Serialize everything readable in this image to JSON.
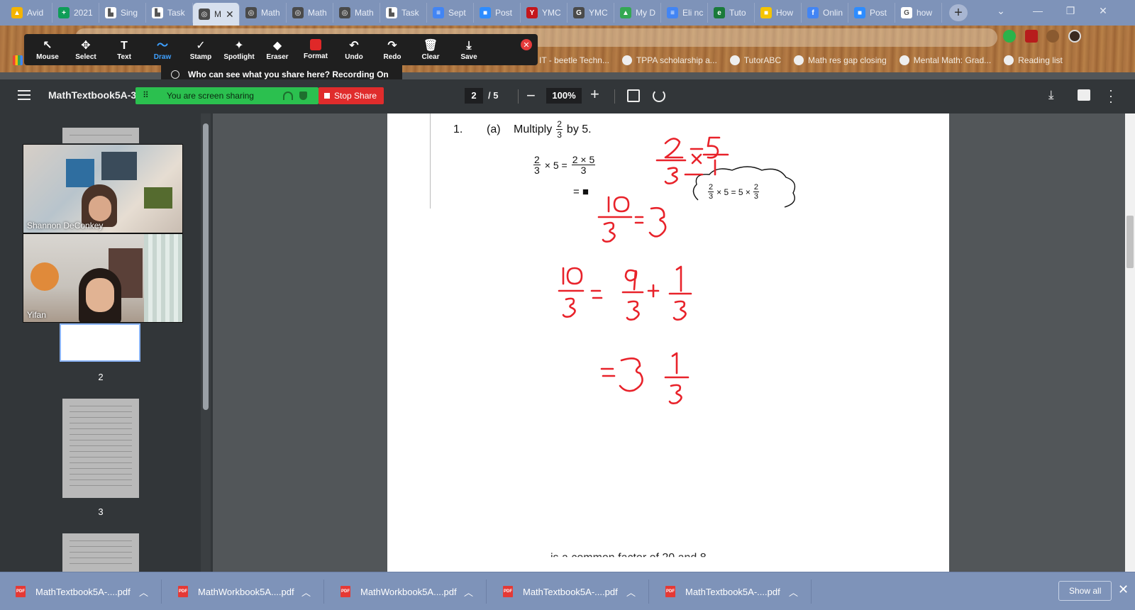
{
  "browser": {
    "tabs": [
      {
        "label": "Avid",
        "color": "#f4b400",
        "glyph": "▲"
      },
      {
        "label": "2021",
        "color": "#0f9d58",
        "glyph": "+"
      },
      {
        "label": "Sing",
        "color": "#ffffff",
        "glyph": "▙"
      },
      {
        "label": "Task",
        "color": "#ffffff",
        "glyph": "▙"
      },
      {
        "label": "M",
        "color": "#4a4a4a",
        "glyph": "◎",
        "active": true
      },
      {
        "label": "Math",
        "color": "#4a4a4a",
        "glyph": "◎"
      },
      {
        "label": "Math",
        "color": "#4a4a4a",
        "glyph": "◎"
      },
      {
        "label": "Math",
        "color": "#4a4a4a",
        "glyph": "◎"
      },
      {
        "label": "Task",
        "color": "#ffffff",
        "glyph": "▙"
      },
      {
        "label": "Sept",
        "color": "#4285f4",
        "glyph": "≡"
      },
      {
        "label": "Post",
        "color": "#2d8cff",
        "glyph": "■"
      },
      {
        "label": "YMC",
        "color": "#c4161c",
        "glyph": "Y"
      },
      {
        "label": "YMC",
        "color": "#4a4a4a",
        "glyph": "G"
      },
      {
        "label": "My D",
        "color": "#34a853",
        "glyph": "▲"
      },
      {
        "label": "Eli nc",
        "color": "#4285f4",
        "glyph": "≡"
      },
      {
        "label": "Tuto",
        "color": "#1a7a3a",
        "glyph": "e"
      },
      {
        "label": "How",
        "color": "#f4c400",
        "glyph": "■"
      },
      {
        "label": "Onlin",
        "color": "#4285f4",
        "glyph": "f"
      },
      {
        "label": "Post",
        "color": "#2d8cff",
        "glyph": "■"
      },
      {
        "label": "how",
        "color": "#ffffff",
        "glyph": "G"
      }
    ]
  },
  "bookmarks": [
    {
      "label": "IT - beetle Techn..."
    },
    {
      "label": "TPPA scholarship a..."
    },
    {
      "label": "TutorABC"
    },
    {
      "label": "Math res gap closing"
    },
    {
      "label": "Mental Math: Grad..."
    },
    {
      "label": "Reading list"
    }
  ],
  "zoom_toolbar": {
    "tools": [
      {
        "label": "Mouse",
        "icon": "↖"
      },
      {
        "label": "Select",
        "icon": "✥"
      },
      {
        "label": "Text",
        "icon": "T"
      },
      {
        "label": "Draw",
        "icon": "〜",
        "active": true
      },
      {
        "label": "Stamp",
        "icon": "✓"
      },
      {
        "label": "Spotlight",
        "icon": "✦"
      },
      {
        "label": "Eraser",
        "icon": "◆"
      },
      {
        "label": "Format",
        "icon": "rec"
      },
      {
        "label": "Undo",
        "icon": "↶"
      },
      {
        "label": "Redo",
        "icon": "↷"
      },
      {
        "label": "Clear",
        "icon": "🗑"
      },
      {
        "label": "Save",
        "icon": "⤓"
      }
    ],
    "share_notice": "Who can see what you share here? Recording On"
  },
  "pdf_toolbar": {
    "title": "MathTextbook5A-3-",
    "sharing_label": "You are screen sharing",
    "stop_share_label": "Stop Share",
    "current_page": "2",
    "page_separator": "/ 5",
    "zoom_level": "100%"
  },
  "sidebar": {
    "participants": [
      {
        "name": "Shannon DeConkey"
      },
      {
        "name": "Yifan"
      }
    ],
    "page_numbers": [
      "2",
      "3"
    ]
  },
  "page": {
    "problem_number": "1.",
    "part_label": "(a)",
    "prompt_before": "Multiply",
    "prompt_after": "by 5.",
    "fraction_num": "2",
    "fraction_den": "3",
    "times_five": "× 5 =",
    "product_num": "2 × 5",
    "product_den": "3",
    "equals_box": "= ■",
    "cloud_left": "× 5 = 5 ×",
    "cut_off_text": "is a common factor of 20 and 8"
  },
  "downloads": {
    "items": [
      {
        "label": "MathTextbook5A-....pdf"
      },
      {
        "label": "MathWorkbook5A....pdf"
      },
      {
        "label": "MathWorkbook5A....pdf"
      },
      {
        "label": "MathTextbook5A-....pdf"
      },
      {
        "label": "MathTextbook5A-....pdf"
      }
    ],
    "show_all_label": "Show all"
  },
  "colors": {
    "ink_red": "#e8222a",
    "share_green": "#2bc04f",
    "stop_red": "#e02c2c",
    "tabstrip": "#7e93b9"
  }
}
